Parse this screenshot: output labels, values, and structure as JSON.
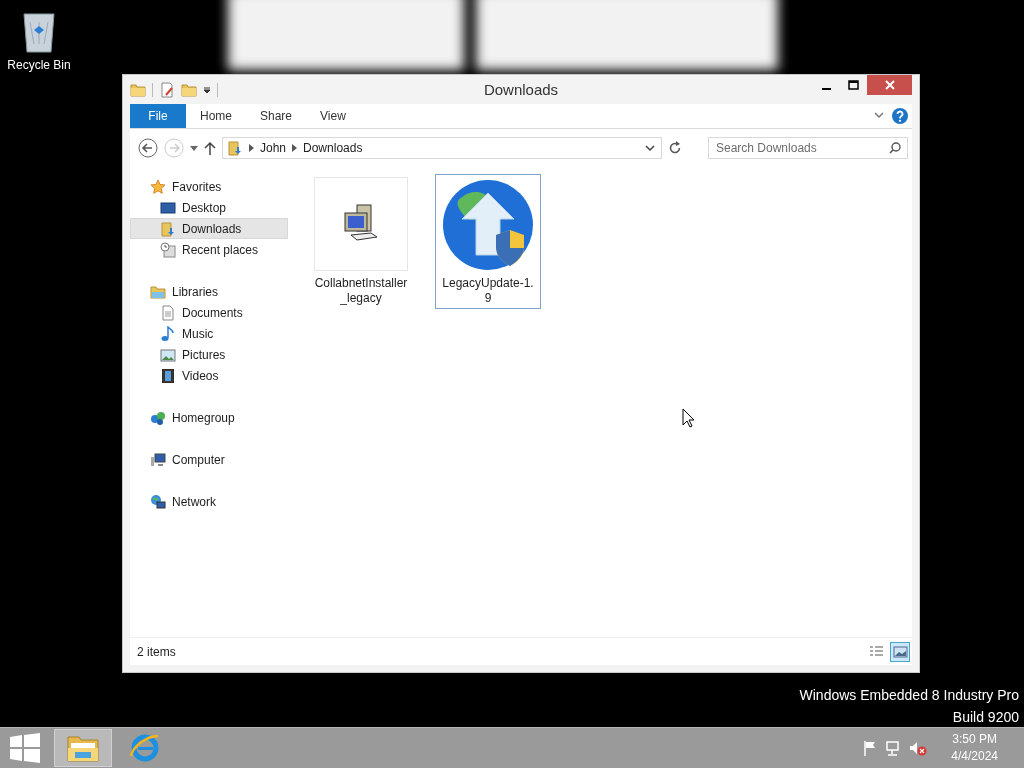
{
  "desktop": {
    "icons": [
      {
        "label": "Recycle Bin"
      }
    ],
    "edition_text": [
      "Windows Embedded 8 Industry Pro",
      "Build 9200"
    ]
  },
  "window": {
    "title": "Downloads",
    "ribbon_tabs": [
      {
        "label": "File",
        "kind": "file"
      },
      {
        "label": "Home",
        "kind": "tab"
      },
      {
        "label": "Share",
        "kind": "tab"
      },
      {
        "label": "View",
        "kind": "tab"
      }
    ],
    "address": {
      "crumbs": [
        "John",
        "Downloads"
      ]
    },
    "search": {
      "placeholder": "Search Downloads"
    },
    "nav": [
      {
        "label": "Favorites",
        "kind": "favorites",
        "selected": false,
        "children": [
          {
            "label": "Desktop",
            "kind": "desktop",
            "selected": false
          },
          {
            "label": "Downloads",
            "kind": "downloads",
            "selected": true
          },
          {
            "label": "Recent places",
            "kind": "recent",
            "selected": false
          }
        ]
      },
      {
        "label": "Libraries",
        "kind": "libraries",
        "selected": false,
        "children": [
          {
            "label": "Documents",
            "kind": "documents",
            "selected": false
          },
          {
            "label": "Music",
            "kind": "music",
            "selected": false
          },
          {
            "label": "Pictures",
            "kind": "pictures",
            "selected": false
          },
          {
            "label": "Videos",
            "kind": "videos",
            "selected": false
          }
        ]
      },
      {
        "label": "Homegroup",
        "kind": "homegroup",
        "selected": false
      },
      {
        "label": "Computer",
        "kind": "computer",
        "selected": false
      },
      {
        "label": "Network",
        "kind": "network",
        "selected": false
      }
    ],
    "files": [
      {
        "name": "CollabnetInstaller_legacy",
        "kind": "installer",
        "selected": false
      },
      {
        "name": "LegacyUpdate-1.9",
        "kind": "update",
        "selected": true
      }
    ],
    "status": {
      "count": "2 items",
      "views": [
        {
          "kind": "details",
          "selected": false
        },
        {
          "kind": "large-icons",
          "selected": true
        }
      ]
    }
  },
  "taskbar": {
    "apps": [
      {
        "kind": "explorer",
        "active": true
      },
      {
        "kind": "browser",
        "active": false
      }
    ],
    "clock": {
      "time": "3:50 PM",
      "date": "4/4/2024"
    }
  }
}
